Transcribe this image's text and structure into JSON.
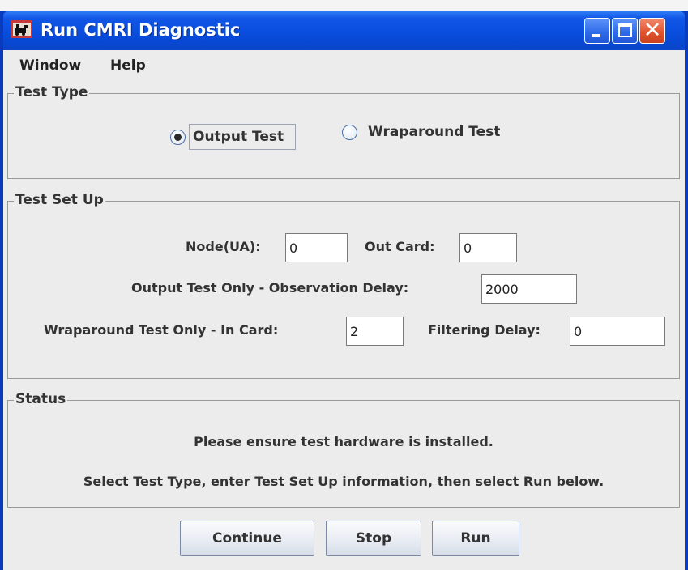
{
  "window": {
    "title": "Run CMRI Diagnostic"
  },
  "menu": [
    "Window",
    "Help"
  ],
  "test_type": {
    "title": "Test Type",
    "options": [
      {
        "label": "Output Test",
        "selected": true
      },
      {
        "label": "Wraparound Test",
        "selected": false
      }
    ]
  },
  "test_setup": {
    "title": "Test Set Up",
    "node_label": "Node(UA):",
    "node_value": "0",
    "out_card_label": "Out Card:",
    "out_card_value": "0",
    "obs_delay_label": "Output Test Only - Observation Delay:",
    "obs_delay_value": "2000",
    "in_card_label": "Wraparound Test Only - In Card:",
    "in_card_value": "2",
    "filter_delay_label": "Filtering Delay:",
    "filter_delay_value": "0"
  },
  "status": {
    "title": "Status",
    "line1": "Please ensure test hardware is installed.",
    "line2": "Select Test Type, enter Test Set Up information, then select Run below."
  },
  "buttons": {
    "continue": "Continue",
    "stop": "Stop",
    "run": "Run"
  },
  "colors": {
    "titlebar": "#0a4fe0",
    "close": "#e25530",
    "client": "#ececec"
  },
  "icons": [
    "app-icon",
    "minimize-icon",
    "maximize-icon",
    "close-icon",
    "radio-checked-icon",
    "radio-unchecked-icon"
  ]
}
